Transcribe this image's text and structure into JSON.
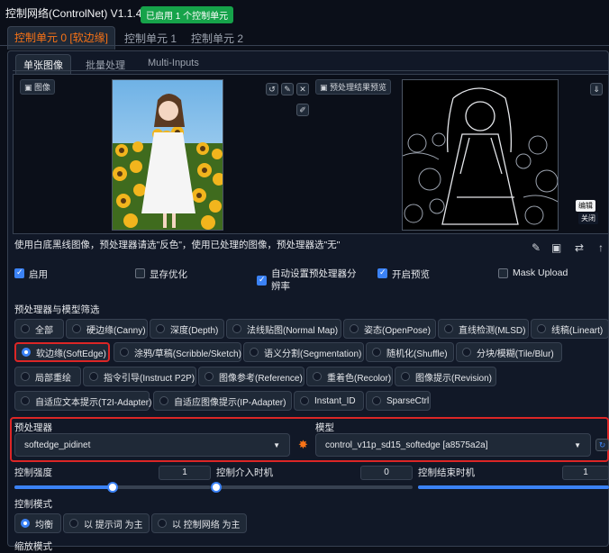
{
  "header": {
    "title": "控制网络(ControlNet) V1.1.443",
    "badge": "已启用 1 个控制单元"
  },
  "unit_tabs": [
    "控制单元 0 [软边缘]",
    "控制单元 1",
    "控制单元 2"
  ],
  "input_tabs": [
    "单张图像",
    "批量处理",
    "Multi-Inputs"
  ],
  "image_panel": {
    "image_label": "图像",
    "preview_button": "预处理结果预览",
    "edit_button": "编辑",
    "close_button": "关闭"
  },
  "hint": "使用白底黑线图像，预处理器请选\"反色\"，使用已处理的图像，预处理器选\"无\"",
  "checkboxes": [
    {
      "label": "启用",
      "checked": true
    },
    {
      "label": "显存优化",
      "checked": false
    },
    {
      "label": "自动设置预处理器分辨率",
      "checked": true
    },
    {
      "label": "开启预览",
      "checked": true
    },
    {
      "label": "Mask Upload",
      "checked": false
    }
  ],
  "filter_title": "预处理器与模型筛选",
  "filters": [
    {
      "label": "全部",
      "selected": false
    },
    {
      "label": "硬边缘(Canny)",
      "selected": false
    },
    {
      "label": "深度(Depth)",
      "selected": false
    },
    {
      "label": "法线贴图(Normal Map)",
      "selected": false
    },
    {
      "label": "姿态(OpenPose)",
      "selected": false
    },
    {
      "label": "直线检测(MLSD)",
      "selected": false
    },
    {
      "label": "线稿(Lineart)",
      "selected": false
    },
    {
      "label": "软边缘(SoftEdge)",
      "selected": true
    },
    {
      "label": "涂鸦/草稿(Scribble/Sketch)",
      "selected": false
    },
    {
      "label": "语义分割(Segmentation)",
      "selected": false
    },
    {
      "label": "随机化(Shuffle)",
      "selected": false
    },
    {
      "label": "分块/模糊(Tile/Blur)",
      "selected": false
    },
    {
      "label": "局部重绘",
      "selected": false
    },
    {
      "label": "指令引导(Instruct P2P)",
      "selected": false
    },
    {
      "label": "图像参考(Reference)",
      "selected": false
    },
    {
      "label": "重着色(Recolor)",
      "selected": false
    },
    {
      "label": "图像提示(Revision)",
      "selected": false
    },
    {
      "label": "自适应文本提示(T2I-Adapter)",
      "selected": false
    },
    {
      "label": "自适应图像提示(IP-Adapter)",
      "selected": false
    },
    {
      "label": "Instant_ID",
      "selected": false
    },
    {
      "label": "SparseCtrl",
      "selected": false
    }
  ],
  "preprocessor": {
    "label": "预处理器",
    "value": "softedge_pidinet"
  },
  "model": {
    "label": "模型",
    "value": "control_v11p_sd15_softedge [a8575a2a]"
  },
  "sliders": [
    {
      "label": "控制强度",
      "value": "1",
      "fraction": 0.5
    },
    {
      "label": "控制介入时机",
      "value": "0",
      "fraction": 0.0
    },
    {
      "label": "控制结束时机",
      "value": "1",
      "fraction": 1.0
    }
  ],
  "control_mode": {
    "label": "控制模式",
    "options": [
      {
        "label": "均衡",
        "selected": true
      },
      {
        "label": "以 提示词 为主",
        "selected": false
      },
      {
        "label": "以 控制网络 为主",
        "selected": false
      }
    ]
  },
  "next_section": "缩放模式",
  "colors": {
    "accent": "#f97316",
    "highlight": "#dc2626",
    "primary": "#3b82f6",
    "badge": "#16a34a"
  }
}
